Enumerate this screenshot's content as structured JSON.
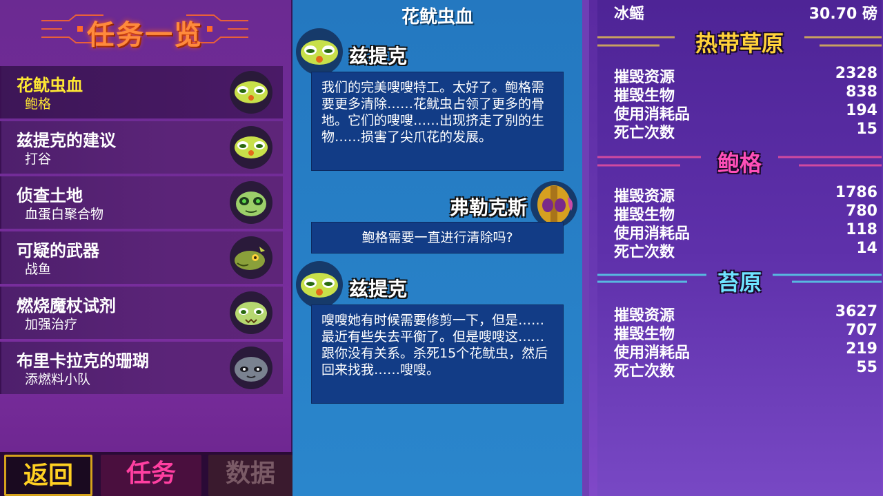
{
  "left_panel": {
    "title": "任务一览",
    "quests": [
      {
        "title": "花鱿虫血",
        "subtitle": "鲍格",
        "icon": "zitik-face-icon",
        "active": true
      },
      {
        "title": "兹提克的建议",
        "subtitle": "打谷",
        "icon": "zitik-face-icon",
        "active": false
      },
      {
        "title": "侦查土地",
        "subtitle": "血蛋白聚合物",
        "icon": "green-alien-icon",
        "active": false
      },
      {
        "title": "可疑的武器",
        "subtitle": "战鱼",
        "icon": "war-fish-icon",
        "active": false
      },
      {
        "title": "燃烧魔杖试剂",
        "subtitle": "加强治疗",
        "icon": "zitik-face-icon",
        "active": false
      },
      {
        "title": "布里卡拉克的珊瑚",
        "subtitle": "添燃料小队",
        "icon": "grey-creature-icon",
        "active": false
      }
    ],
    "tabs": {
      "back": "返回",
      "quests": "任务",
      "data": "数据"
    }
  },
  "dialog": {
    "title": "花鱿虫血",
    "messages": [
      {
        "speaker": "兹提克",
        "text": "我们的完美嗖嗖特工。太好了。鲍格需要更多清除……花鱿虫占领了更多的骨地。它们的嗖嗖……出现挤走了别的生物……损害了尖爪花的发展。"
      },
      {
        "speaker": "弗勒克斯",
        "text": "鲍格需要一直进行清除吗?"
      },
      {
        "speaker": "兹提克",
        "text": "嗖嗖她有时候需要修剪一下，但是……最近有些失去平衡了。但是嗖嗖这……跟你没有关系。杀死15个花鱿虫，然后回来找我……嗖嗖。"
      }
    ]
  },
  "stats": {
    "top_row": {
      "label": "冰鳐",
      "value": "30.70 磅"
    },
    "regions": [
      {
        "name": "热带草原",
        "color": "#ffd23a",
        "rows": [
          {
            "label": "摧毁资源",
            "value": "2328"
          },
          {
            "label": "摧毁生物",
            "value": "838"
          },
          {
            "label": "使用消耗品",
            "value": "194"
          },
          {
            "label": "死亡次数",
            "value": "15"
          }
        ]
      },
      {
        "name": "鲍格",
        "color": "#ff4fb8",
        "rows": [
          {
            "label": "摧毁资源",
            "value": "1786"
          },
          {
            "label": "摧毁生物",
            "value": "780"
          },
          {
            "label": "使用消耗品",
            "value": "118"
          },
          {
            "label": "死亡次数",
            "value": "14"
          }
        ]
      },
      {
        "name": "苔原",
        "color": "#6fe4ff",
        "rows": [
          {
            "label": "摧毁资源",
            "value": "3627"
          },
          {
            "label": "摧毁生物",
            "value": "707"
          },
          {
            "label": "使用消耗品",
            "value": "219"
          },
          {
            "label": "死亡次数",
            "value": "55"
          }
        ]
      }
    ]
  }
}
